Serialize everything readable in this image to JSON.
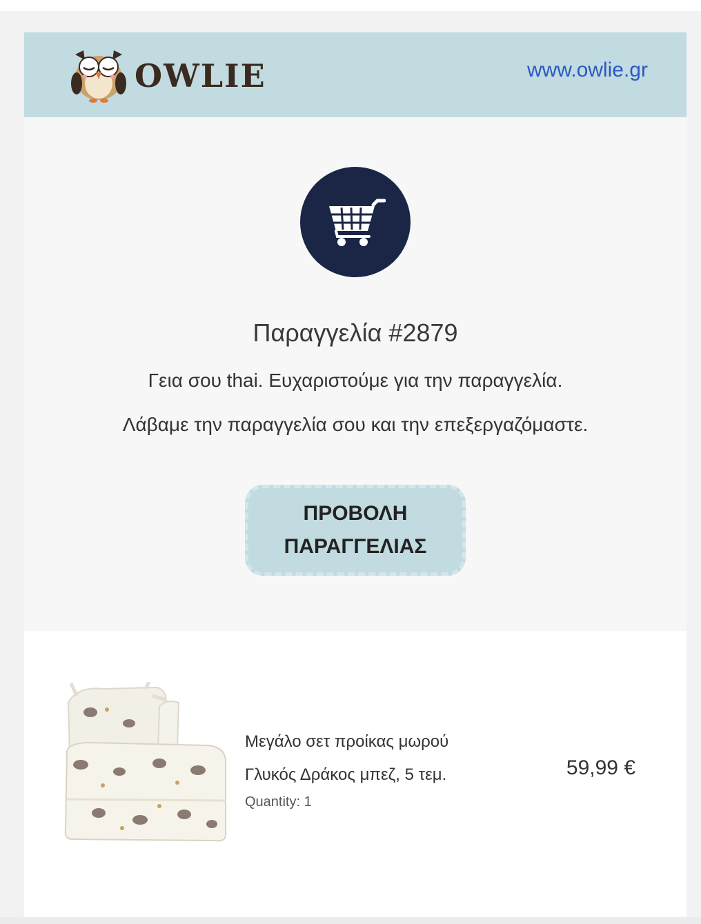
{
  "header": {
    "brand_name": "OWLIE",
    "website": "www.owlie.gr"
  },
  "hero": {
    "icon": "shopping-cart-icon",
    "order_title": "Παραγγελία #2879",
    "greeting": "Γεια σου thai. Ευχαριστούμε για την παραγγελία.",
    "received_text": "Λάβαμε την παραγγελία σου και την επεξεργαζόμαστε.",
    "view_order_button": "ΠΡΟΒΟΛΗ ΠΑΡΑΓΓΕΛΙΑΣ"
  },
  "items": [
    {
      "name": "Μεγάλο σετ προίκας μωρού Γλυκός Δράκος μπεζ, 5 τεμ.",
      "quantity": "Quantity: 1",
      "price": "59,99 €"
    }
  ],
  "colors": {
    "header_bg": "#c1dbe0",
    "icon_circle": "#1b2545",
    "link": "#2b59c3",
    "button_bg": "#c1dbe0"
  }
}
